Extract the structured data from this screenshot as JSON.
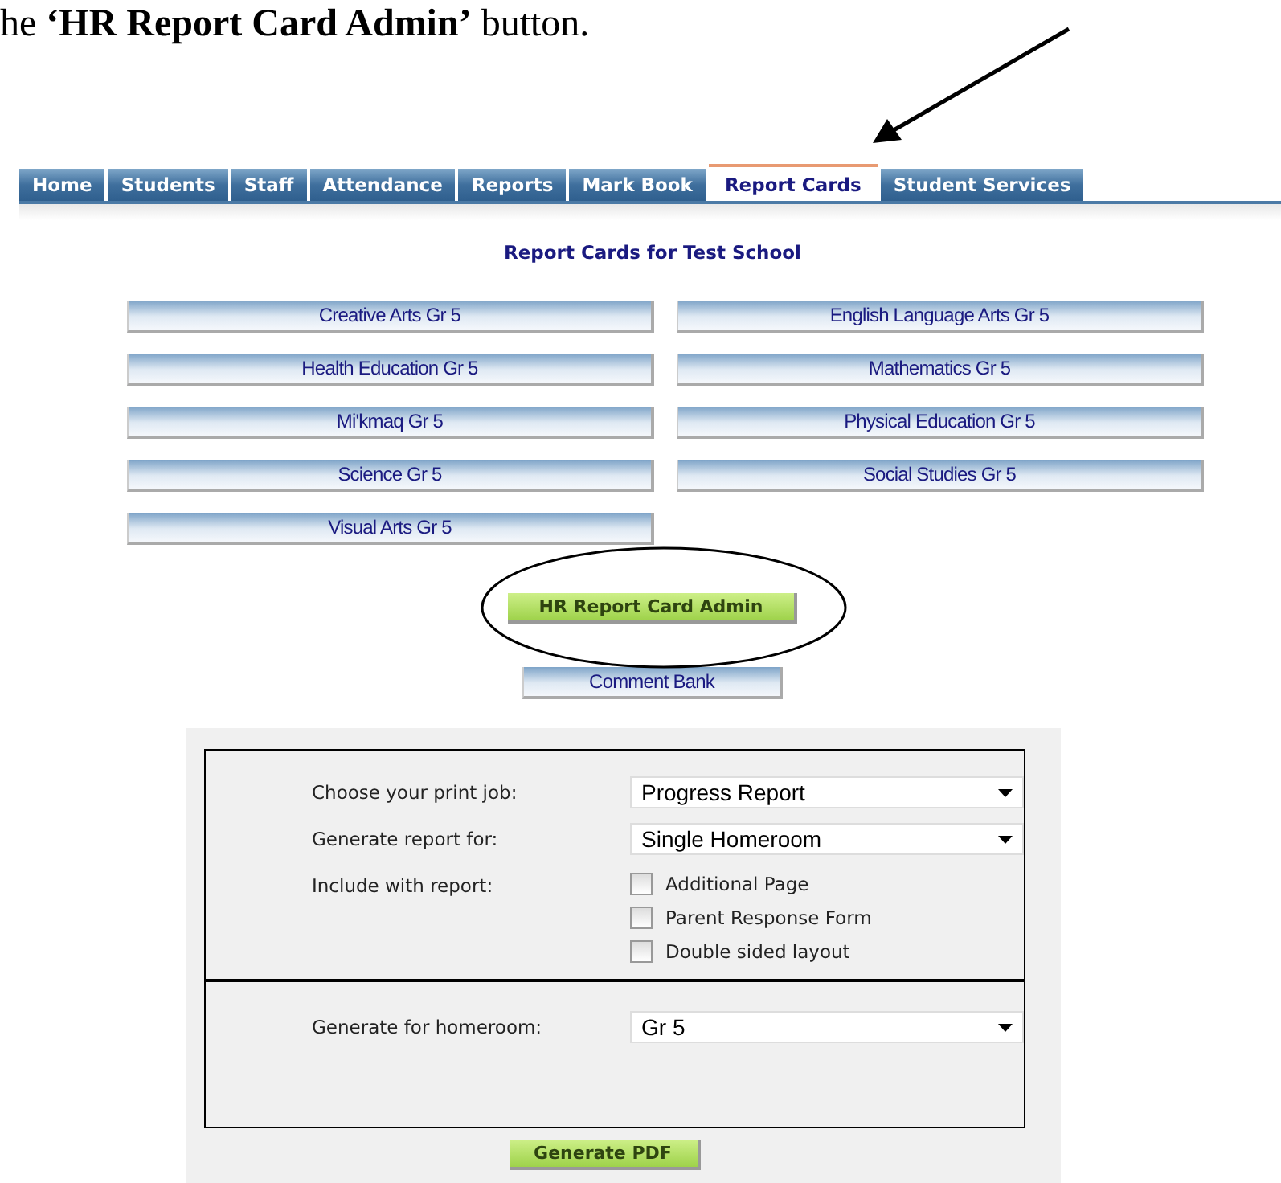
{
  "caption": "he **‘HR Report Card Admin’** button.",
  "tabs": [
    {
      "label": "Home",
      "selected": false
    },
    {
      "label": "Students",
      "selected": false
    },
    {
      "label": "Staff",
      "selected": false
    },
    {
      "label": "Attendance",
      "selected": false
    },
    {
      "label": "Reports",
      "selected": false
    },
    {
      "label": "Mark Book",
      "selected": false
    },
    {
      "label": "Report Cards",
      "selected": true
    },
    {
      "label": "Student Services",
      "selected": false
    }
  ],
  "page_title": "Report Cards for Test School",
  "course_buttons": [
    "Creative Arts Gr 5",
    "English Language Arts Gr 5",
    "Health Education Gr 5",
    "Mathematics Gr 5",
    "Mi'kmaq Gr 5",
    "Physical Education Gr 5",
    "Science Gr 5",
    "Social Studies Gr 5",
    "Visual Arts Gr 5"
  ],
  "admin_button": "HR Report Card Admin",
  "comment_bank_button": "Comment Bank",
  "form": {
    "print_job": {
      "label": "Choose your print job:",
      "value": "Progress Report"
    },
    "report_for": {
      "label": "Generate report for:",
      "value": "Single Homeroom"
    },
    "include": {
      "label": "Include with report:",
      "options": [
        {
          "label": "Additional Page",
          "checked": false
        },
        {
          "label": "Parent Response Form",
          "checked": false
        },
        {
          "label": "Double sided layout",
          "checked": false
        }
      ]
    },
    "homeroom": {
      "label": "Generate for homeroom:",
      "value": "Gr 5"
    },
    "generate_button": "Generate PDF"
  }
}
